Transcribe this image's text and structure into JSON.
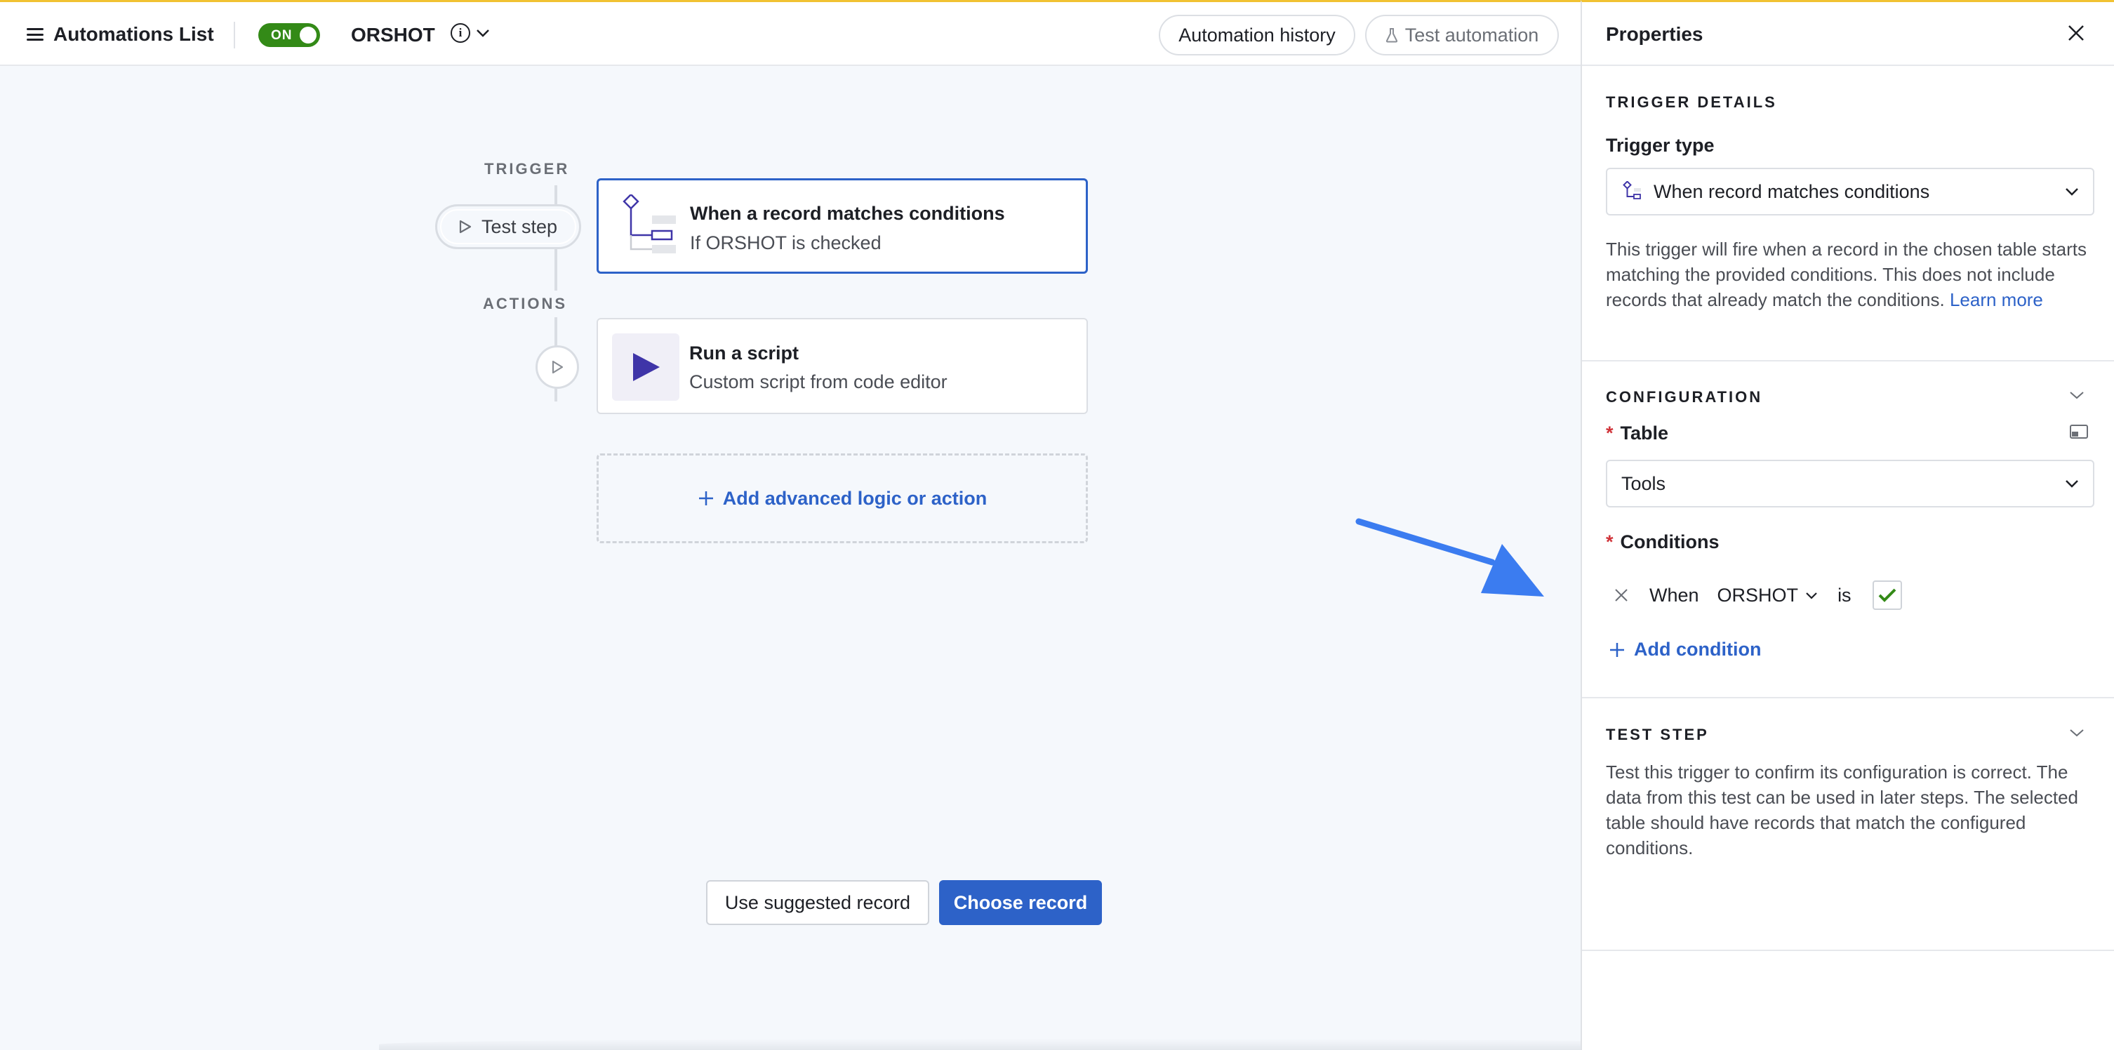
{
  "topbar": {
    "menu_label": "Automations List",
    "toggle_label": "ON",
    "automation_name": "ORSHOT",
    "info_glyph": "i",
    "history_button": "Automation history",
    "test_button": "Test automation"
  },
  "flow": {
    "trigger_label": "TRIGGER",
    "actions_label": "ACTIONS",
    "test_step_label": "Test step",
    "trigger_card": {
      "title": "When a record matches conditions",
      "subtitle": "If ORSHOT is checked"
    },
    "action_card": {
      "title": "Run a script",
      "subtitle": "Custom script from code editor"
    },
    "add_label": "Add advanced logic or action"
  },
  "panel": {
    "title": "Properties",
    "trigger_details": {
      "heading": "TRIGGER DETAILS",
      "type_label": "Trigger type",
      "type_value": "When record matches conditions",
      "description": "This trigger will fire when a record in the chosen table starts matching the provided conditions. This does not include records that already match the conditions.",
      "learn_more": "Learn more"
    },
    "configuration": {
      "heading": "CONFIGURATION",
      "table_label": "Table",
      "table_value": "Tools",
      "conditions_label": "Conditions",
      "condition": {
        "when": "When",
        "field": "ORSHOT",
        "operator": "is",
        "checked": true
      },
      "add_condition": "Add condition"
    },
    "test_step": {
      "heading": "TEST STEP",
      "description": "Test this trigger to confirm its configuration is correct. The data from this test can be used in later steps. The selected table should have records that match the configured conditions.",
      "secondary_button": "Use suggested record",
      "primary_button": "Choose record"
    }
  },
  "colors": {
    "accent": "#2d62c8",
    "toggle_on": "#338a17",
    "arrow": "#3b7cf0",
    "script_icon": "#3f35a8",
    "top_border": "#f1c232"
  },
  "icons": [
    "menu-icon",
    "info-icon",
    "chevron-down-icon",
    "flask-icon",
    "play-icon",
    "trigger-conditions-icon",
    "script-play-icon",
    "plus-icon",
    "close-icon",
    "table-expand-icon",
    "checkmark-icon"
  ]
}
